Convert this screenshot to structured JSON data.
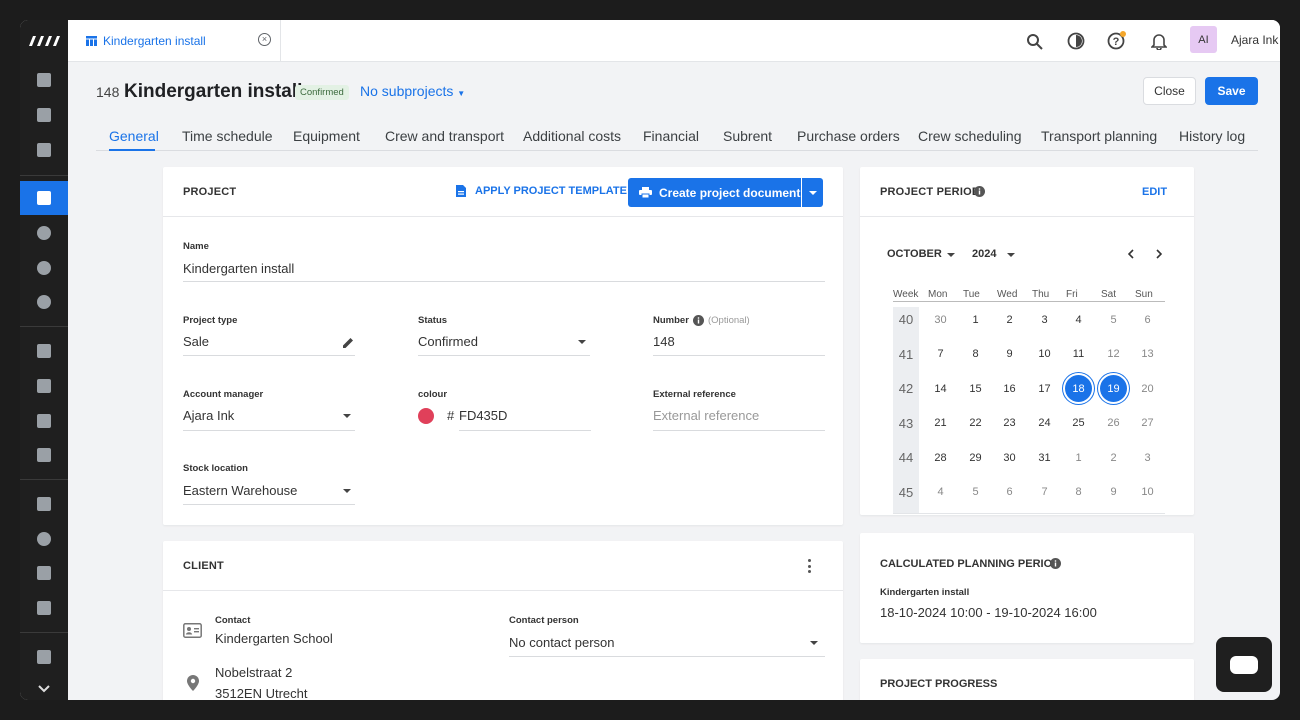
{
  "topbar": {
    "open_tab": "Kindergarten install",
    "user_initials": "AI",
    "user_name": "Ajara Ink"
  },
  "header": {
    "number": "148",
    "title": "Kindergarten install",
    "status_badge": "Confirmed",
    "subprojects": "No subprojects",
    "close_label": "Close",
    "save_label": "Save"
  },
  "tabs": [
    "General",
    "Time schedule",
    "Equipment",
    "Crew and transport",
    "Additional costs",
    "Financial",
    "Subrent",
    "Purchase orders",
    "Crew scheduling",
    "Transport planning",
    "History log"
  ],
  "project": {
    "title": "PROJECT",
    "apply_template": "APPLY PROJECT TEMPLATE",
    "create_document": "Create project document",
    "name_label": "Name",
    "name_value": "Kindergarten install",
    "type_label": "Project type",
    "type_value": "Sale",
    "status_label": "Status",
    "status_value": "Confirmed",
    "number_label": "Number",
    "number_optional": "(Optional)",
    "number_value": "148",
    "manager_label": "Account manager",
    "manager_value": "Ajara Ink",
    "colour_label": "colour",
    "colour_hash": "#",
    "colour_value": "FD435D",
    "colour_hex": "#e0405a",
    "extref_label": "External reference",
    "extref_placeholder": "External reference",
    "stock_label": "Stock location",
    "stock_value": "Eastern Warehouse"
  },
  "client": {
    "title": "CLIENT",
    "contact_label": "Contact",
    "contact_value": "Kindergarten School",
    "person_label": "Contact person",
    "person_value": "No contact person",
    "address_line1": "Nobelstraat 2",
    "address_line2": "3512EN Utrecht"
  },
  "period": {
    "title": "PROJECT PERIOD",
    "edit": "EDIT",
    "month": "OCTOBER",
    "year": "2024",
    "headers": [
      "Week",
      "Mon",
      "Tue",
      "Wed",
      "Thu",
      "Fri",
      "Sat",
      "Sun"
    ],
    "weeks": [
      {
        "wk": "40",
        "days": [
          "30",
          "1",
          "2",
          "3",
          "4",
          "5",
          "6"
        ]
      },
      {
        "wk": "41",
        "days": [
          "7",
          "8",
          "9",
          "10",
          "11",
          "12",
          "13"
        ]
      },
      {
        "wk": "42",
        "days": [
          "14",
          "15",
          "16",
          "17",
          "18",
          "19",
          "20"
        ]
      },
      {
        "wk": "43",
        "days": [
          "21",
          "22",
          "23",
          "24",
          "25",
          "26",
          "27"
        ]
      },
      {
        "wk": "44",
        "days": [
          "28",
          "29",
          "30",
          "31",
          "1",
          "2",
          "3"
        ]
      },
      {
        "wk": "45",
        "days": [
          "4",
          "5",
          "6",
          "7",
          "8",
          "9",
          "10"
        ]
      }
    ],
    "calc_title": "CALCULATED PLANNING PERIOD",
    "calc_name": "Kindergarten install",
    "calc_range": "18-10-2024 10:00 - 19-10-2024 16:00"
  },
  "progress": {
    "title": "PROJECT PROGRESS"
  },
  "colors": {
    "accent": "#1a73e8",
    "sidebar": "#1f1f1f"
  }
}
